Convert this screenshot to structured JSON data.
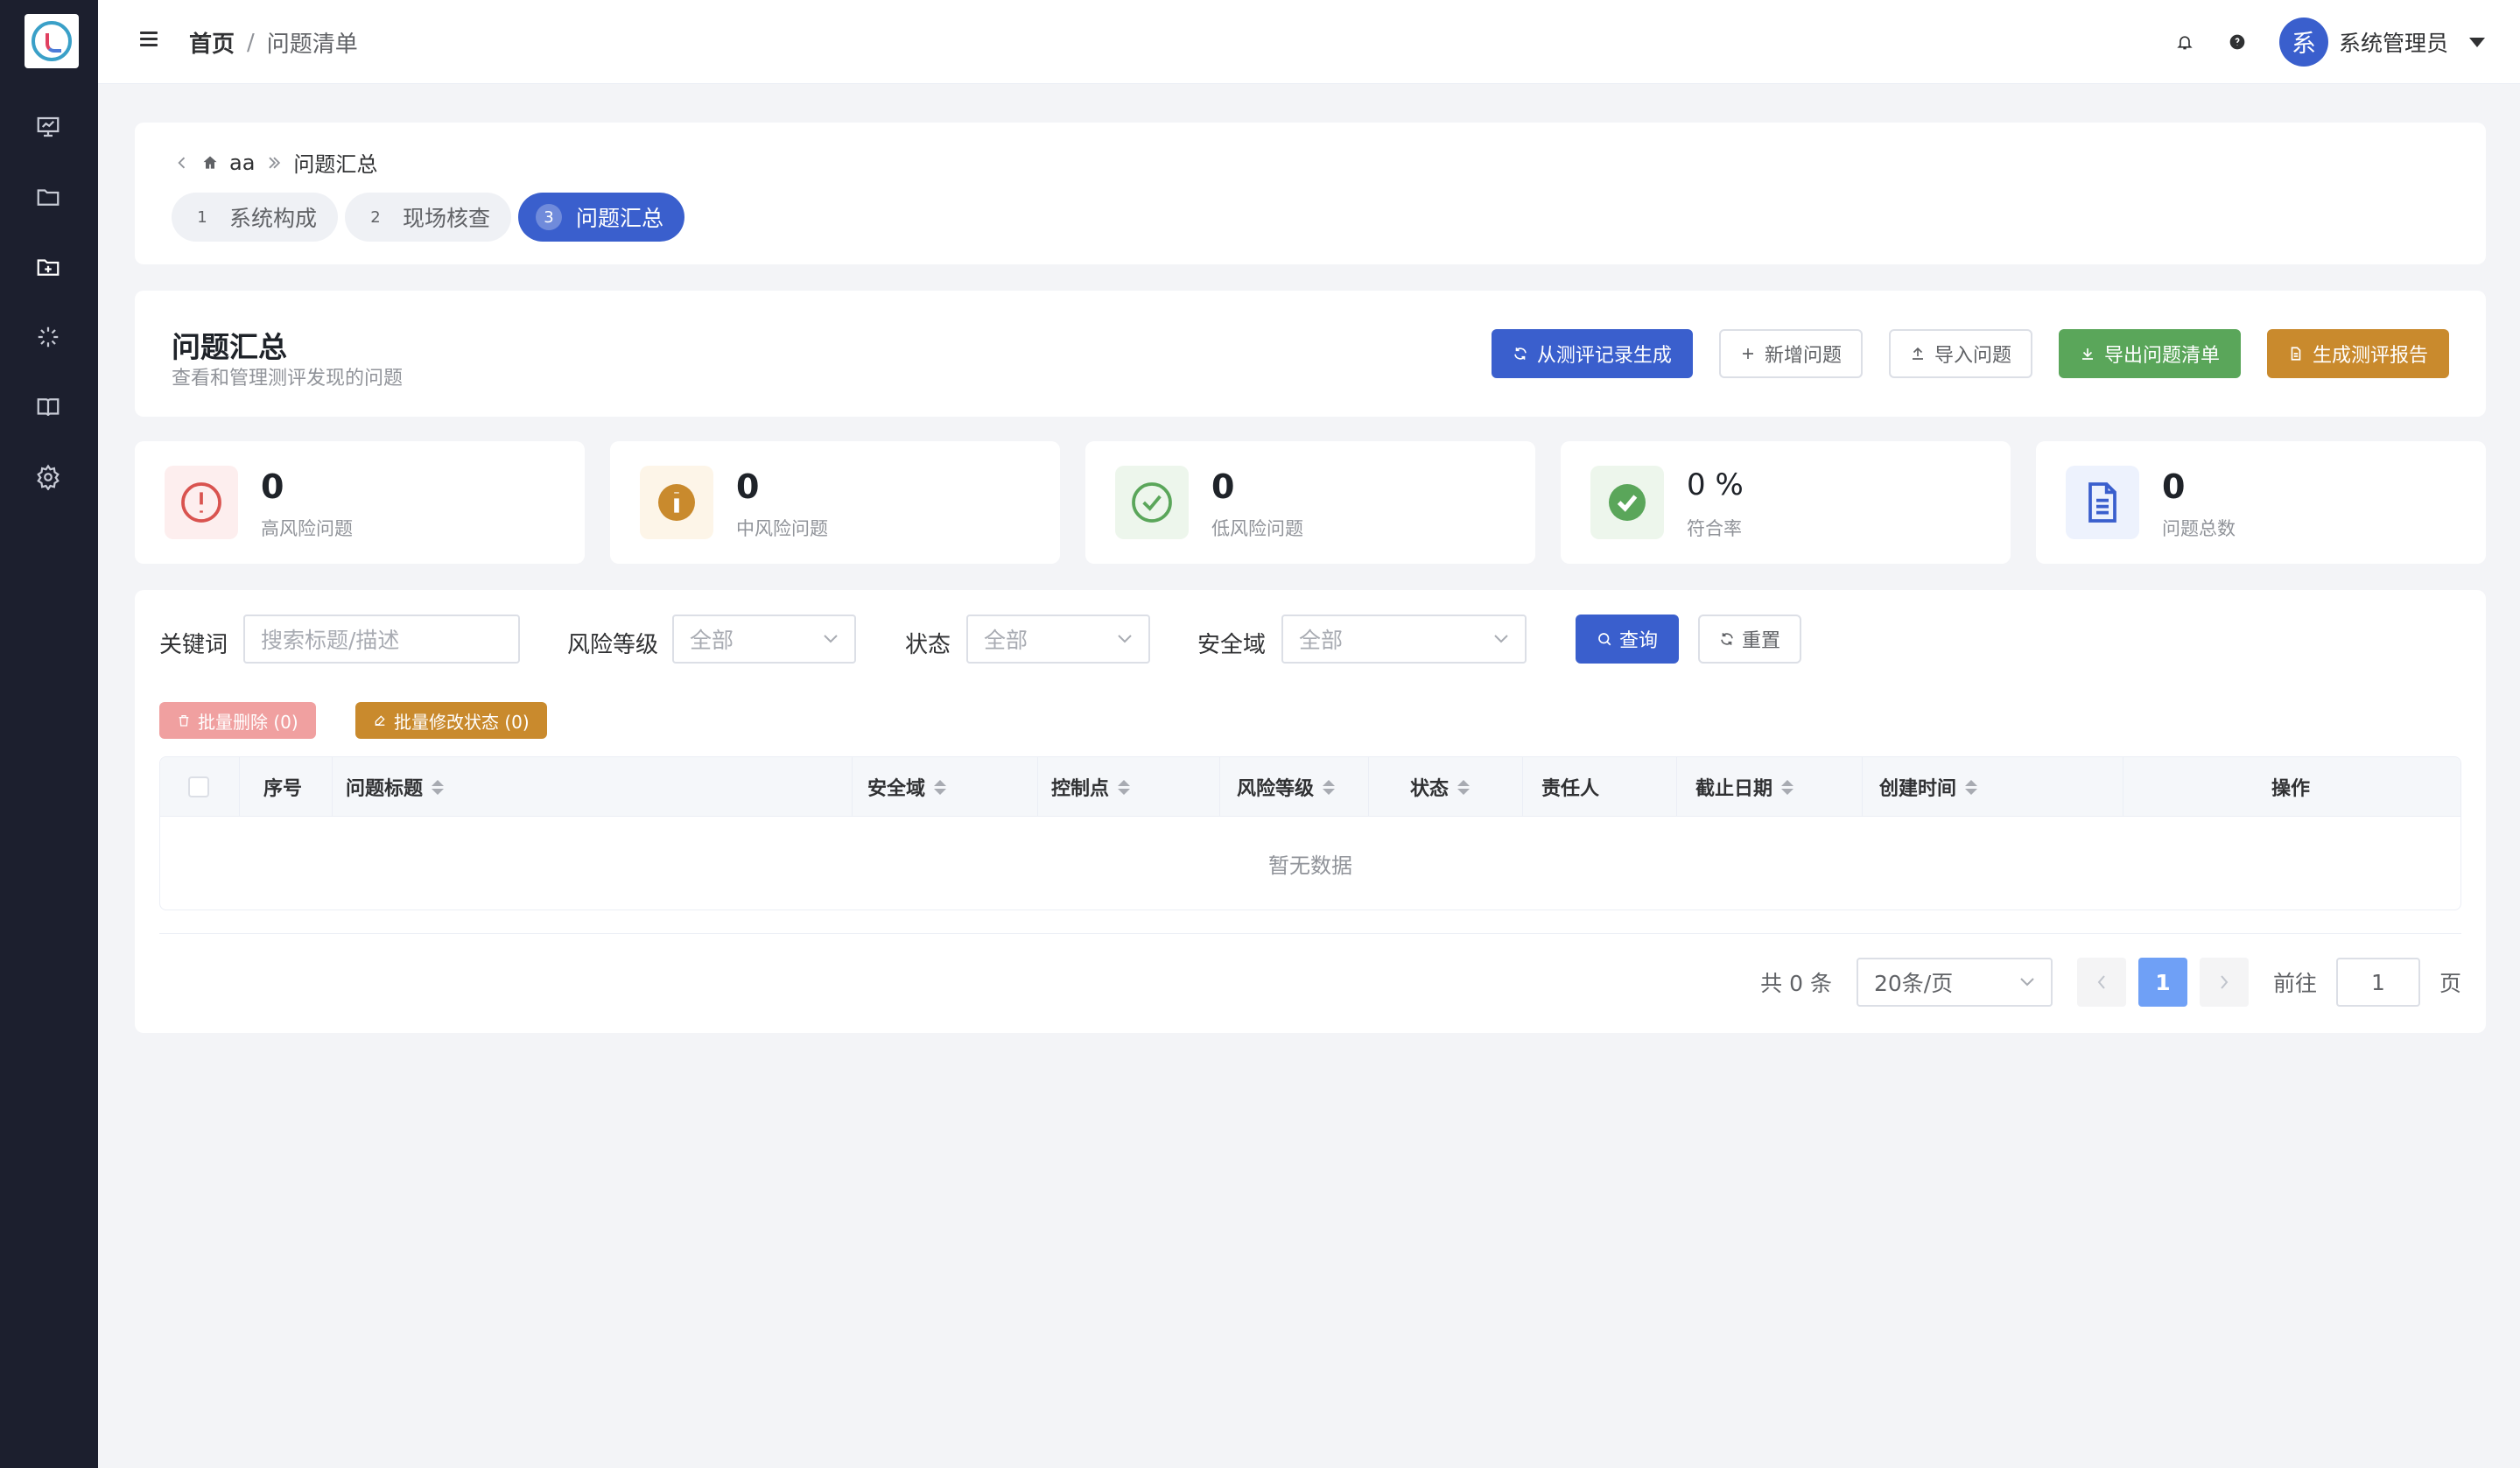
{
  "topbar": {
    "breadcrumb_home": "首页",
    "breadcrumb_sep": "/",
    "breadcrumb_current": "问题清单",
    "avatar_text": "系",
    "username": "系统管理员"
  },
  "sidebar": {
    "icons": [
      "presentation-icon",
      "folder-icon",
      "folder-add-icon",
      "loading-icon",
      "book-icon",
      "gear-icon"
    ]
  },
  "nav": {
    "project": "aa",
    "current": "问题汇总",
    "steps": [
      {
        "num": "1",
        "label": "系统构成"
      },
      {
        "num": "2",
        "label": "现场核查"
      },
      {
        "num": "3",
        "label": "问题汇总"
      }
    ]
  },
  "header": {
    "title": "问题汇总",
    "subtitle": "查看和管理测评发现的问题",
    "actions": {
      "generate": "从测评记录生成",
      "add": "新增问题",
      "import": "导入问题",
      "export": "导出问题清单",
      "report": "生成测评报告"
    }
  },
  "stats": [
    {
      "value": "0",
      "label": "高风险问题",
      "color": "#d9534f",
      "bg": "#fdeeee"
    },
    {
      "value": "0",
      "label": "中风险问题",
      "color": "#c98a2d",
      "bg": "#fdf5e8"
    },
    {
      "value": "0",
      "label": "低风险问题",
      "color": "#5aa65a",
      "bg": "#edf6ec"
    },
    {
      "value": "0 %",
      "label": "符合率",
      "color": "#5aa65a",
      "bg": "#edf6ec"
    },
    {
      "value": "0",
      "label": "问题总数",
      "color": "#3a5fcd",
      "bg": "#edf2fd"
    }
  ],
  "filters": {
    "keyword_label": "关键词",
    "keyword_placeholder": "搜索标题/描述",
    "risk_label": "风险等级",
    "risk_value": "全部",
    "status_label": "状态",
    "status_value": "全部",
    "domain_label": "安全域",
    "domain_value": "全部",
    "query": "查询",
    "reset": "重置"
  },
  "batch": {
    "delete": "批量删除 (0)",
    "modify": "批量修改状态 (0)"
  },
  "table": {
    "columns": [
      "序号",
      "问题标题",
      "安全域",
      "控制点",
      "风险等级",
      "状态",
      "责任人",
      "截止日期",
      "创建时间",
      "操作"
    ],
    "empty": "暂无数据"
  },
  "pagination": {
    "total": "共 0 条",
    "page_size": "20条/页",
    "current_page": "1",
    "goto_label": "前往",
    "goto_value": "1",
    "page_suffix": "页"
  },
  "colors": {
    "sidebar_bg": "#1c1f2e",
    "primary": "#3a5fcd",
    "success": "#5aa65a",
    "warning": "#c98a2d",
    "danger_light": "#f0a0a0"
  }
}
